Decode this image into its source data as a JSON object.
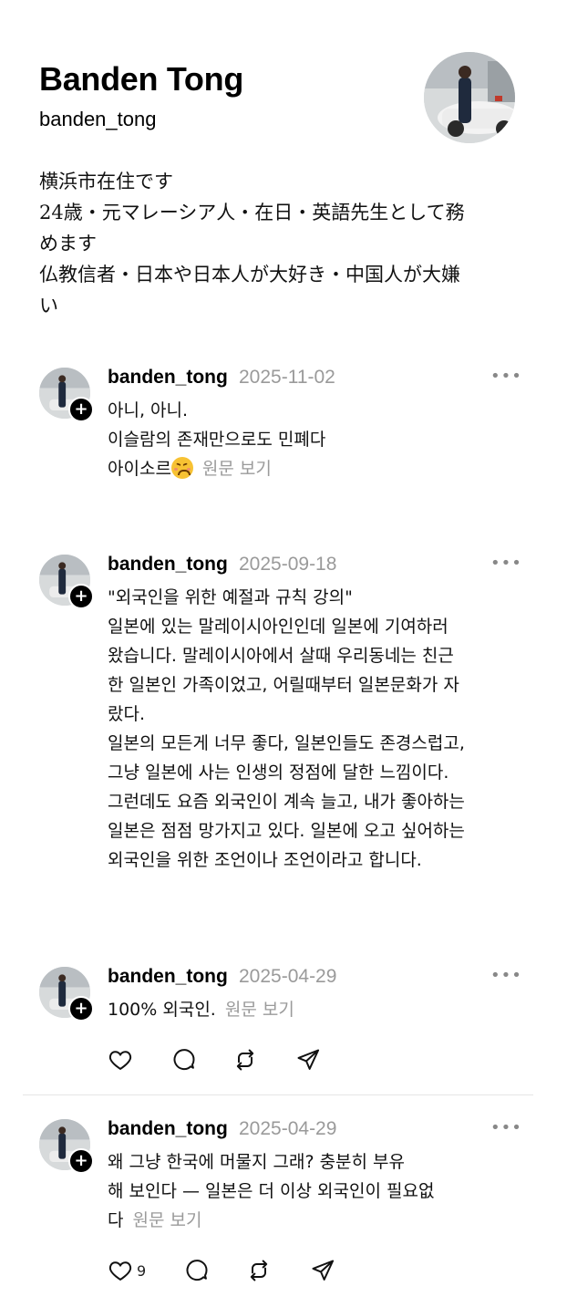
{
  "profile": {
    "name": "Banden Tong",
    "handle": "banden_tong",
    "bio_lines": [
      "横浜市在住です",
      "24歳・元マレーシア人・在日・英語先生として務",
      "めます",
      "仏教信者・日本や日本人が大好き・中国人が大嫌",
      "い"
    ]
  },
  "posts": [
    {
      "username": "banden_tong",
      "date": "2025-11-02",
      "lines": [
        "아니, 아니.",
        "이슬람의 존재만으로도 민폐다",
        "아이소르"
      ],
      "emoji": "confounded-face",
      "view_original": "원문 보기"
    },
    {
      "username": "banden_tong",
      "date": "2025-09-18",
      "lines": [
        "\"외국인을 위한 예절과 규칙 강의\"",
        "일본에 있는 말레이시아인인데 일본에 기여하러",
        "왔습니다. 말레이시아에서 살때 우리동네는 친근",
        "한 일본인 가족이었고, 어릴때부터 일본문화가 자",
        "랐다.",
        "일본의 모든게 너무 좋다, 일본인들도 존경스럽고,",
        "그냥 일본에 사는 인생의 정점에 달한 느낌이다.",
        "그런데도 요즘 외국인이 계속 늘고, 내가 좋아하는",
        "일본은 점점 망가지고 있다. 일본에 오고 싶어하는",
        "외국인을 위한 조언이나 조언이라고 합니다."
      ]
    },
    {
      "username": "banden_tong",
      "date": "2025-04-29",
      "lines": [
        "100% 외국인."
      ],
      "view_original": "원문 보기"
    },
    {
      "username": "banden_tong",
      "date": "2025-04-29",
      "lines": [
        "왜 그냥 한국에 머물지 그래? 충분히 부유",
        "해 보인다 — 일본은 더 이상 외국인이 필요없",
        "다"
      ],
      "view_original": "원문 보기",
      "like_count": "9"
    }
  ],
  "icons": {
    "more": "more-icon",
    "like": "heart-icon",
    "comment": "comment-icon",
    "repost": "repost-icon",
    "share": "share-icon",
    "follow": "plus-icon"
  }
}
